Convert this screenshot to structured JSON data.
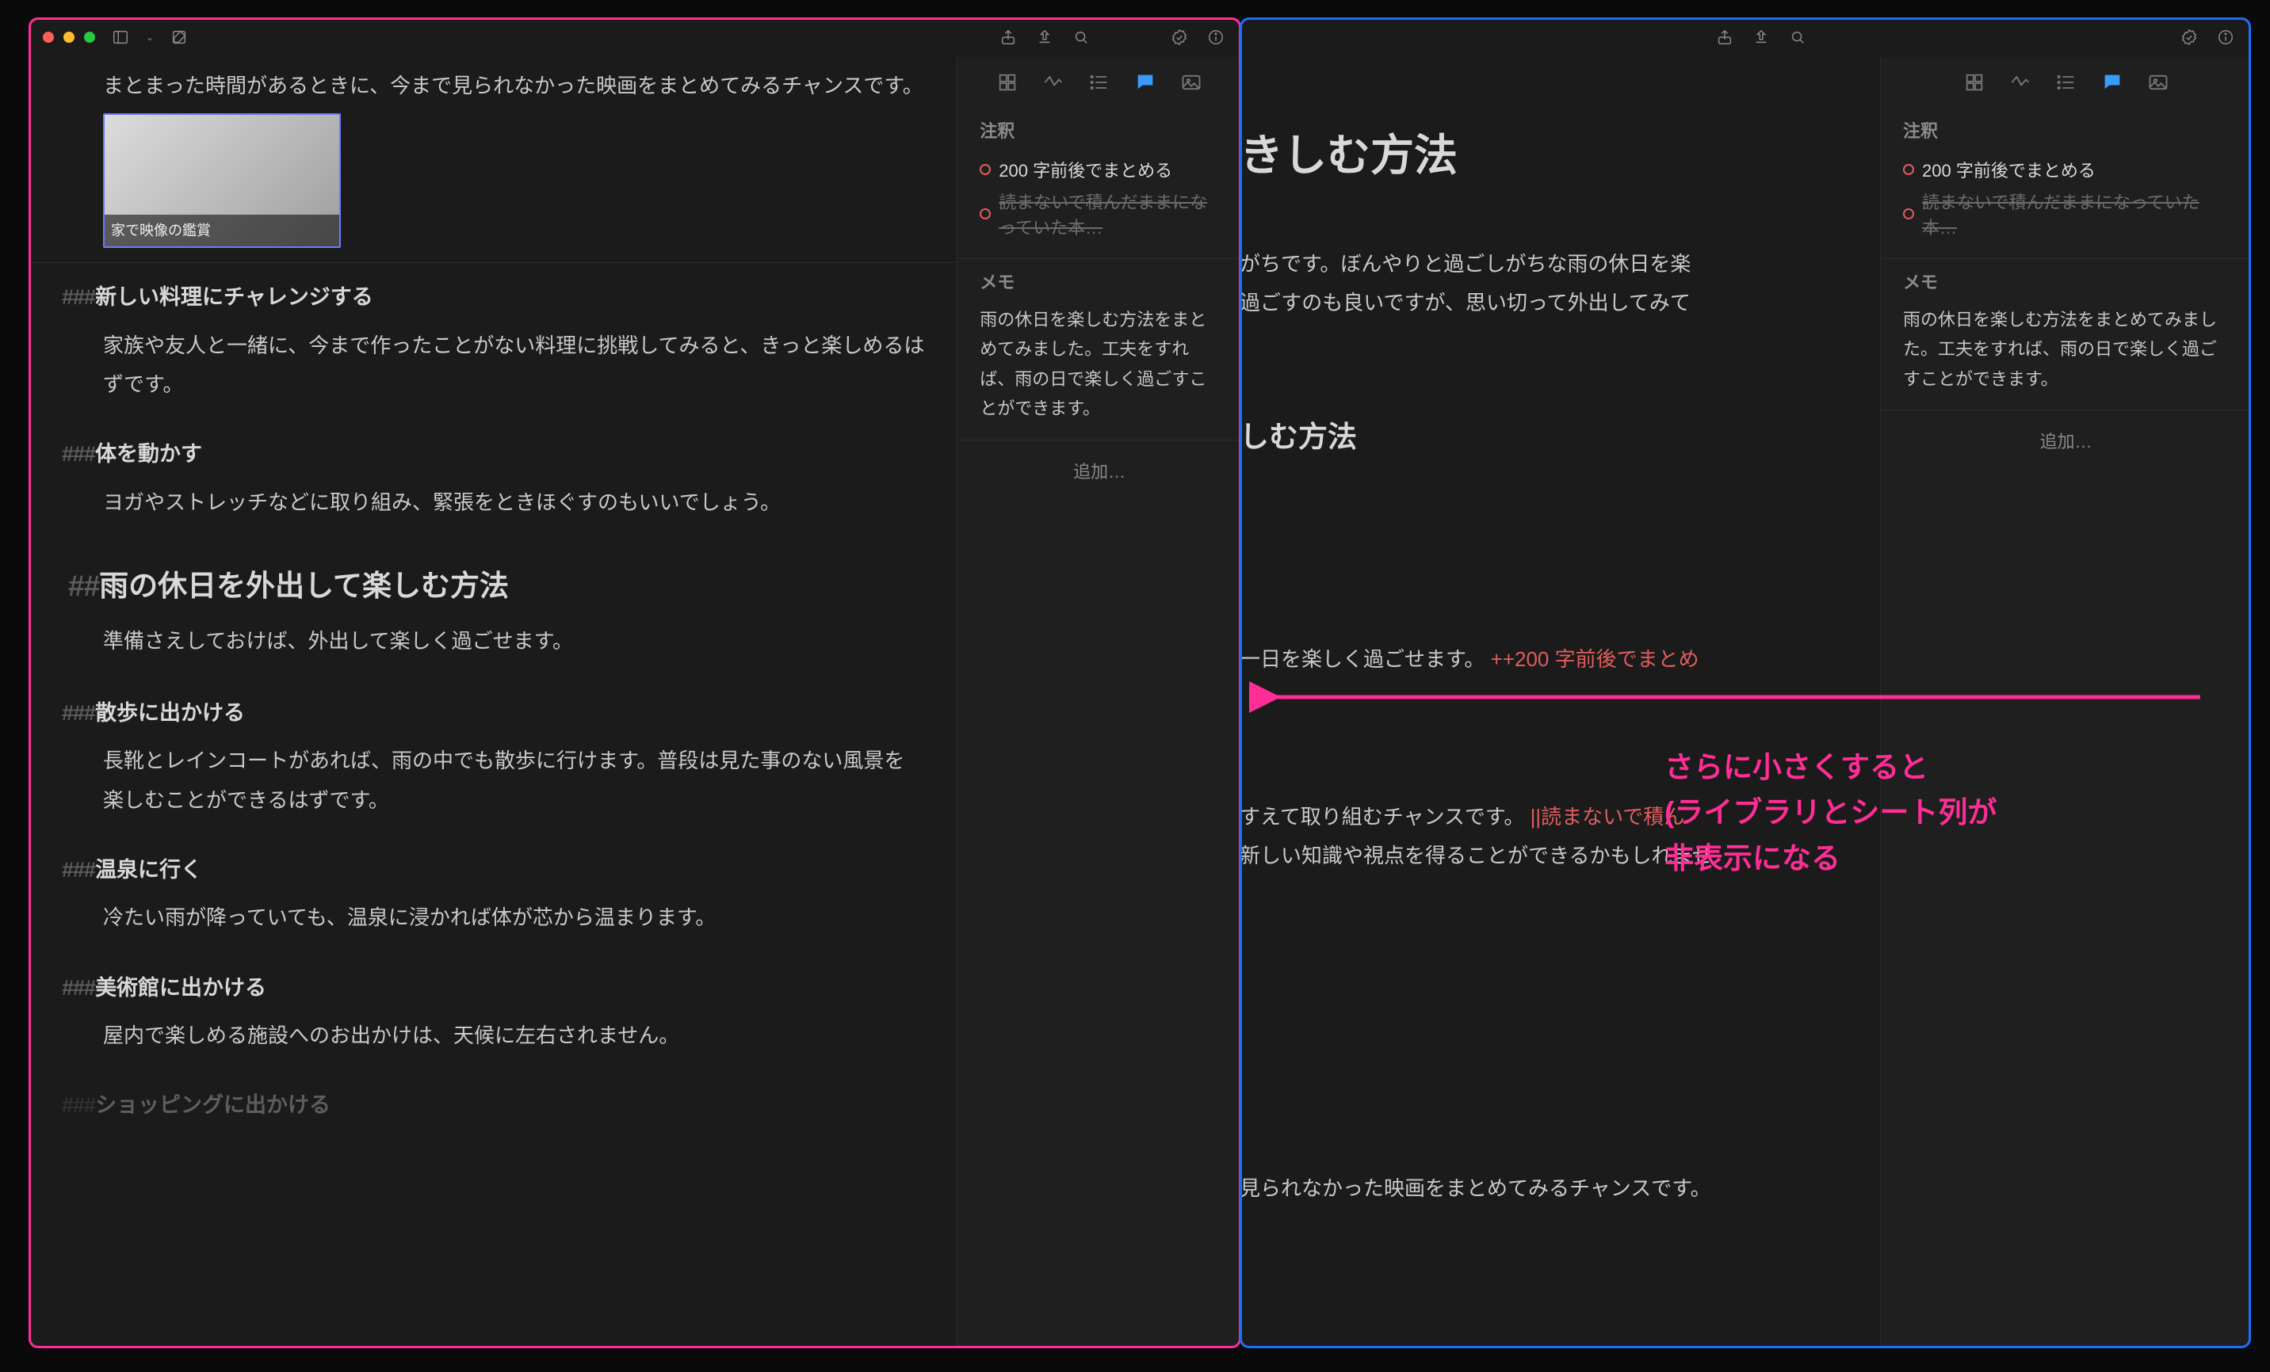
{
  "left": {
    "intro_para": "まとまった時間があるときに、今まで見られなかった映画をまとめてみるチャンスです。",
    "thumb_caption": "家で映像の鑑賞",
    "sections": [
      {
        "mk": "###",
        "h": "新しい料理にチャレンジする",
        "p": "家族や友人と一緒に、今まで作ったことがない料理に挑戦してみると、きっと楽しめるはずです。"
      },
      {
        "mk": "###",
        "h": "体を動かす",
        "p": "ヨガやストレッチなどに取り組み、緊張をときほぐすのもいいでしょう。"
      }
    ],
    "h2_mk": "##",
    "h2": "雨の休日を外出して楽しむ方法",
    "h2_sub": "準備さえしておけば、外出して楽しく過ごせます。",
    "sections2": [
      {
        "mk": "###",
        "h": "散歩に出かける",
        "p": "長靴とレインコートがあれば、雨の中でも散歩に行けます。普段は見た事のない風景を楽しむことができるはずです。"
      },
      {
        "mk": "###",
        "h": "温泉に行く",
        "p": "冷たい雨が降っていても、温泉に浸かれば体が芯から温まります。"
      },
      {
        "mk": "###",
        "h": "美術館に出かける",
        "p": "屋内で楽しめる施設へのお出かけは、天候に左右されません。"
      },
      {
        "mk": "###",
        "h": "ショッピングに出かける",
        "p": ""
      }
    ]
  },
  "right": {
    "title_frag": "きしむ方法",
    "lead1": "がちです。ぼんやりと過ごしがちな雨の休日を楽",
    "lead2": "過ごすのも良いですが、思い切って外出してみて",
    "h2_frag": "しむ方法",
    "line_tail": "一日を楽しく過ごせます。",
    "inline_anno": "++200 字前後でまとめ",
    "body_a": "すえて取り組むチャンスです。",
    "body_a_anno": "||読まないで積ん",
    "body_b": "新しい知識や視点を得ることができるかもしれませ",
    "body_c": "見られなかった映画をまとめてみるチャンスです。"
  },
  "side": {
    "annot_label": "注釈",
    "annot1": "200 字前後でまとめる",
    "annot2": "読まないで積んだままになっていた本…",
    "memo_label": "メモ",
    "memo_text": "雨の休日を楽しむ方法をまとめてみました。工夫をすれば、雨の日で楽しく過ごすことができます。",
    "add_label": "追加…"
  },
  "overlay": {
    "l1": "さらに小さくすると",
    "l2": "(ライブラリとシート列が",
    "l3": "非表示になる"
  }
}
